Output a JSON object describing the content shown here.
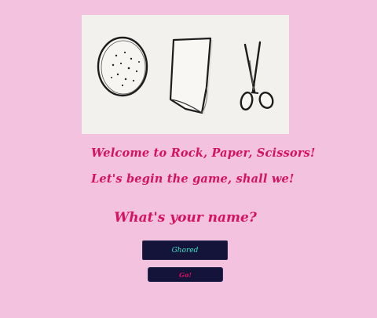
{
  "hero": {
    "image_icons": [
      "rock-icon",
      "paper-icon",
      "scissors-icon"
    ]
  },
  "intro": {
    "welcome": "Welcome to Rock, Paper, Scissors!",
    "begin": "Let's begin the game, shall we!"
  },
  "prompt": {
    "question": "What's your name?"
  },
  "name_form": {
    "input_value": "Ghored",
    "go_label": "Go!"
  },
  "colors": {
    "background": "#f2c2de",
    "accent": "#d6115f",
    "input_background": "#14143a",
    "input_text": "#3ee0c8"
  }
}
